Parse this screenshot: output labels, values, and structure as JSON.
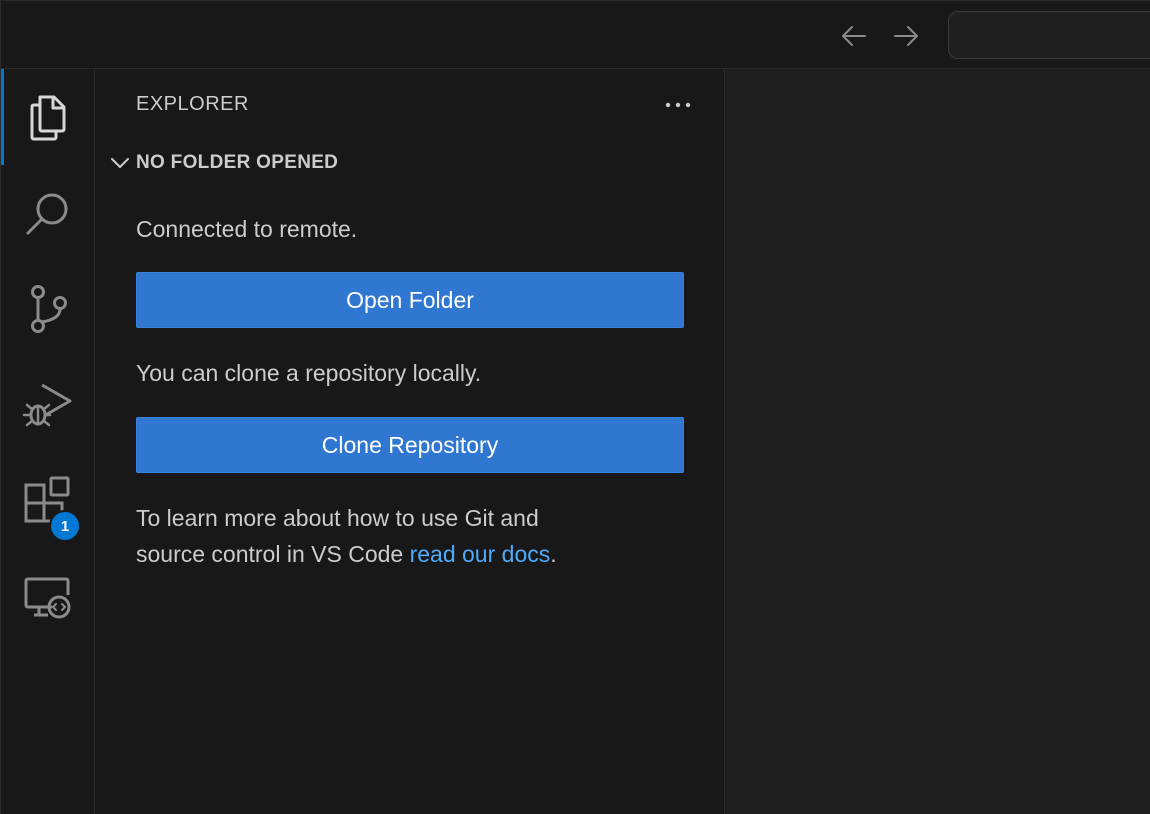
{
  "titlebar": {
    "back_icon": "arrow-left-icon",
    "forward_icon": "arrow-right-icon",
    "command_center_text": ""
  },
  "activitybar": {
    "items": [
      {
        "name": "explorer",
        "icon": "files-icon",
        "active": true
      },
      {
        "name": "search",
        "icon": "search-icon",
        "active": false
      },
      {
        "name": "source-control",
        "icon": "source-control-icon",
        "active": false
      },
      {
        "name": "run-and-debug",
        "icon": "run-debug-icon",
        "active": false
      },
      {
        "name": "extensions",
        "icon": "extensions-icon",
        "active": false,
        "badge": "1"
      },
      {
        "name": "remote-explorer",
        "icon": "remote-explorer-icon",
        "active": false
      }
    ],
    "accent_color": "#0078d4"
  },
  "sidebar": {
    "title": "EXPLORER",
    "more_actions_icon": "ellipsis-icon",
    "section": {
      "label": "NO FOLDER OPENED",
      "chevron_icon": "chevron-down-icon"
    },
    "connected_text": "Connected to remote.",
    "open_folder_label": "Open Folder",
    "clone_text": "You can clone a repository locally.",
    "clone_button_label": "Clone Repository",
    "learn_more_line1": "To learn more about how to use Git and",
    "learn_more_line2_prefix": "source control in VS Code ",
    "docs_link_text": "read our docs",
    "learn_more_suffix": "."
  },
  "colors": {
    "button": "#2f77d1",
    "link": "#4daafc",
    "background": "#181818"
  }
}
